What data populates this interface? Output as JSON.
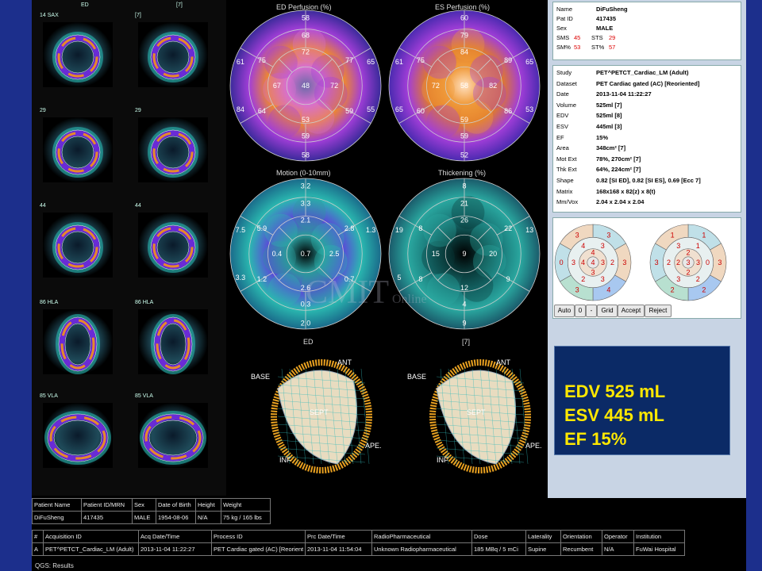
{
  "slices": [
    {
      "left": "14 SAX",
      "right": "[7]",
      "left_tag": "ED",
      "right_tag": "[7]"
    },
    {
      "left": "29",
      "right": "29"
    },
    {
      "left": "44",
      "right": "44"
    },
    {
      "left": "86 HLA",
      "right": "86 HLA"
    },
    {
      "left": "85 VLA",
      "right": "85 VLA"
    }
  ],
  "top_tags": {
    "left": "ED",
    "right": "[7]"
  },
  "polar": {
    "ed_perfusion": {
      "title": "ED Perfusion (%)",
      "values": [
        "58",
        "68",
        "72",
        "77",
        "75",
        "61",
        "65",
        "67",
        "48",
        "72",
        "53",
        "59",
        "64",
        "84",
        "59",
        "58",
        "55"
      ]
    },
    "es_perfusion": {
      "title": "ES Perfusion (%)",
      "values": [
        "60",
        "79",
        "84",
        "89",
        "75",
        "61",
        "65",
        "72",
        "58",
        "82",
        "59",
        "86",
        "60",
        "65",
        "59",
        "52",
        "53"
      ]
    },
    "motion": {
      "title": "Motion (0-10mm)",
      "values": [
        "3.2",
        "3.3",
        "2.1",
        "2.8",
        "5.9",
        "7.5",
        "1.3",
        "0.4",
        "0.7",
        "2.5",
        "2.6",
        "0.7",
        "1.2",
        "3.3",
        "0.3",
        "2.0"
      ],
      "caption": "ED"
    },
    "thickening": {
      "title": "Thickening (%)",
      "values": [
        "8",
        "21",
        "26",
        "22",
        "8",
        "19",
        "13",
        "15",
        "9",
        "20",
        "12",
        "9",
        "8",
        "5",
        "4",
        "9"
      ],
      "caption": "[7]"
    }
  },
  "mesh_labels": {
    "base": "BASE",
    "ant": "ANT",
    "sept": "SEPT",
    "inf": "INF",
    "ape": "APE."
  },
  "watermark": {
    "main": "CMIT",
    "sub": "Online"
  },
  "info": {
    "patient": [
      {
        "k": "Name",
        "v": "DiFuSheng"
      },
      {
        "k": "Pat ID",
        "v": "417435"
      },
      {
        "k": "Sex",
        "v": "MALE"
      }
    ],
    "sms": {
      "k1": "SMS",
      "v1": "45",
      "k2": "STS",
      "v2": "29"
    },
    "smp": {
      "k1": "SM%",
      "v1": "53",
      "k2": "ST%",
      "v2": "57"
    },
    "study": [
      {
        "k": "Study",
        "v": "PET^PETCT_Cardiac_LM (Adult)"
      },
      {
        "k": "Dataset",
        "v": "PET Cardiac gated (AC) [Reoriented]"
      },
      {
        "k": "Date",
        "v": "2013-11-04 11:22:27"
      },
      {
        "k": "Volume",
        "v": "525ml [7]"
      },
      {
        "k": "EDV",
        "v": "525ml [8]"
      },
      {
        "k": "ESV",
        "v": "445ml [3]"
      },
      {
        "k": "EF",
        "v": "15%"
      },
      {
        "k": "Area",
        "v": "348cm² [7]"
      },
      {
        "k": "Mot Ext",
        "v": "78%, 270cm² [7]"
      },
      {
        "k": "Thk Ext",
        "v": "64%, 224cm² [7]"
      },
      {
        "k": "Shape",
        "v": "0.82 [SI ED], 0.82 [SI ES], 0.69 [Ecc 7]"
      },
      {
        "k": "Matrix",
        "v": "168x168 x 82(z) x 8(t)"
      },
      {
        "k": "Mm/Vox",
        "v": "2.04 x 2.04 x 2.04"
      }
    ],
    "score1": {
      "outer": [
        "3",
        "3",
        "4",
        "3",
        "0",
        "3"
      ],
      "mid": [
        "3",
        "2",
        "3",
        "2",
        "3",
        "4"
      ],
      "apex": [
        "4",
        "3",
        "3",
        "4"
      ],
      "center": "4"
    },
    "score2": {
      "outer": [
        "1",
        "3",
        "2",
        "2",
        "3",
        "1"
      ],
      "mid": [
        "1",
        "0",
        "2",
        "3",
        "2",
        "3"
      ],
      "apex": [
        "2",
        "3",
        "2",
        "2"
      ],
      "center": "3"
    },
    "buttons": [
      "Auto",
      "0",
      "-",
      "Grid",
      "Accept",
      "Reject"
    ]
  },
  "summary": {
    "edv": "EDV 525 mL",
    "esv": "ESV 445 mL",
    "ef": "EF 15%"
  },
  "patient_table": {
    "headers": [
      "Patient Name",
      "Patient ID/MRN",
      "Sex",
      "Date of Birth",
      "Height",
      "Weight"
    ],
    "row": [
      "DiFuSheng",
      "417435",
      "MALE",
      "1954-08-06",
      "N/A",
      "75 kg / 165 lbs"
    ]
  },
  "study_table": {
    "headers": [
      "#",
      "Acquisition ID",
      "Acq Date/Time",
      "Process ID",
      "Prc Date/Time",
      "RadioPharmaceutical",
      "Dose",
      "Laterality",
      "Orientation",
      "Operator",
      "Institution"
    ],
    "row": [
      "A",
      "PET^PETCT_Cardiac_LM (Adult)",
      "2013-11-04 11:22:27",
      "PET Cardiac gated (AC) [Reoriented]",
      "2013-11-04 11:54:04",
      "Unknown Radiopharmaceutical",
      "185 MBq / 5 mCi",
      "Supine",
      "Recumbent",
      "N/A",
      "FuWai Hospital"
    ]
  },
  "status": "QGS: Results",
  "colors": {
    "background": "#1c2f8c",
    "summary_text": "#ffe800",
    "summary_bg": "#0b2a66",
    "red_value": "#dd0000"
  }
}
